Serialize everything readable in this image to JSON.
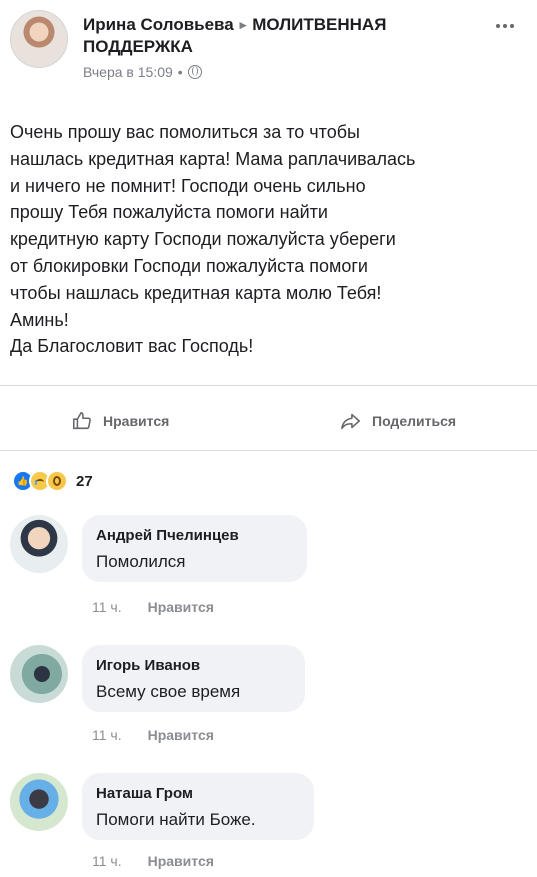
{
  "post": {
    "author": "Ирина Соловьева",
    "arrow": "▸",
    "group": "МОЛИТВЕННАЯ ПОДДЕРЖКА",
    "timestamp": "Вчера в 15:09",
    "dot": "•",
    "lines": [
      "Очень прошу вас помолиться за то чтобы",
      "нашлась кредитная карта! Мама раплачивалась",
      "и ничего не помнит! Господи очень сильно",
      "прошу Тебя пожалуйста помоги найти",
      "кредитную карту Господи пожалуйста убереги",
      "от блокировки Господи пожалуйста помоги",
      "чтобы нашлась кредитная карта молю Тебя!",
      "Аминь!",
      "Да Благословит вас Господь!"
    ]
  },
  "actions": {
    "like_label": "Нравится",
    "share_label": "Поделиться"
  },
  "reactions": {
    "count": "27",
    "types": [
      "like",
      "sad",
      "wow"
    ]
  },
  "comments": [
    {
      "name": "Андрей Пчелинцев",
      "text": "Помолился",
      "time": "11 ч.",
      "like_label": "Нравится"
    },
    {
      "name": "Игорь Иванов",
      "text": "Всему свое время",
      "time": "11 ч.",
      "like_label": "Нравится"
    },
    {
      "name": "Наташа Гром",
      "text": "Помоги найти Боже.",
      "time": "11 ч.",
      "like_label": "Нравится"
    }
  ],
  "icons": {
    "more": "more-icon",
    "globe": "globe-icon",
    "like": "thumbs-up-icon",
    "share": "share-icon"
  },
  "colors": {
    "text": "#1c1e21",
    "secondary": "#65676b",
    "bubble": "#f0f2f5",
    "brand": "#1877f2"
  }
}
